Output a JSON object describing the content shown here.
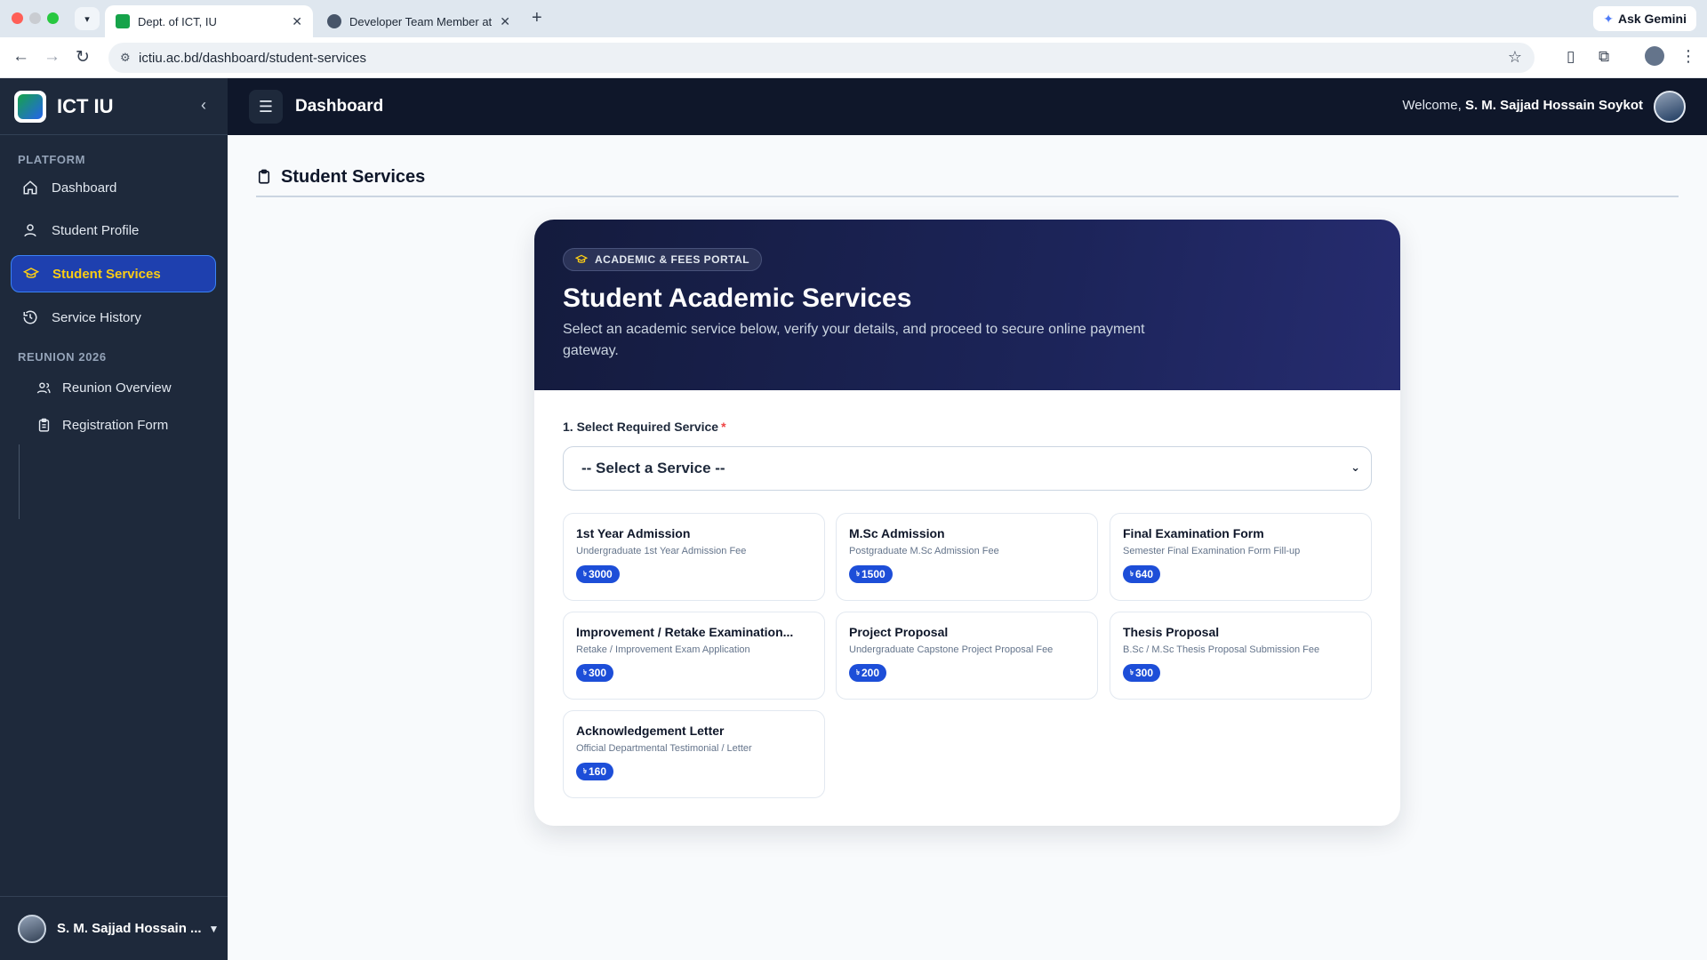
{
  "browser": {
    "tabs": [
      {
        "title": "Dept. of ICT, IU",
        "favicon_color": "#16a34a"
      },
      {
        "title": "Developer Team Member at D",
        "favicon_color": "#475569"
      }
    ],
    "url": "ictiu.ac.bd/dashboard/student-services",
    "ask_gemini": "Ask Gemini"
  },
  "sidebar": {
    "brand": "ICT IU",
    "platform_label": "PLATFORM",
    "items": [
      {
        "label": "Dashboard",
        "icon": "home-icon"
      },
      {
        "label": "Student Profile",
        "icon": "user-icon"
      },
      {
        "label": "Student Services",
        "icon": "graduation-cap-icon",
        "active": true
      },
      {
        "label": "Service History",
        "icon": "history-icon"
      }
    ],
    "reunion_label": "REUNION 2026",
    "reunion_items": [
      {
        "label": "Reunion Overview",
        "icon": "users-icon"
      },
      {
        "label": "Registration Form",
        "icon": "clipboard-icon"
      }
    ],
    "user": "S. M. Sajjad Hossain ..."
  },
  "header": {
    "title": "Dashboard",
    "welcome_prefix": "Welcome,",
    "user_name": "S. M. Sajjad Hossain Soykot"
  },
  "page": {
    "title": "Student Services"
  },
  "hero": {
    "badge": "ACADEMIC & FEES PORTAL",
    "title": "Student Academic Services",
    "subtitle": "Select an academic service below, verify your details, and proceed to secure online payment gateway."
  },
  "form": {
    "label": "1. Select Required Service",
    "required_mark": "*",
    "select_value": "-- Select a Service --"
  },
  "currency_symbol": "৳",
  "services": [
    {
      "title": "1st Year Admission",
      "desc": "Undergraduate 1st Year Admission Fee",
      "price": "3000"
    },
    {
      "title": "M.Sc Admission",
      "desc": "Postgraduate M.Sc Admission Fee",
      "price": "1500"
    },
    {
      "title": "Final Examination Form",
      "desc": "Semester Final Examination Form Fill-up",
      "price": "640"
    },
    {
      "title": "Improvement / Retake Examination...",
      "desc": "Retake / Improvement Exam Application",
      "price": "300"
    },
    {
      "title": "Project Proposal",
      "desc": "Undergraduate Capstone Project Proposal Fee",
      "price": "200"
    },
    {
      "title": "Thesis Proposal",
      "desc": "B.Sc / M.Sc Thesis Proposal Submission Fee",
      "price": "300"
    },
    {
      "title": "Acknowledgement Letter",
      "desc": "Official Departmental Testimonial / Letter",
      "price": "160"
    }
  ],
  "colors": {
    "sidebar_bg": "#1e293b",
    "header_bg": "#0f172a",
    "active_text": "#facc15",
    "price_badge": "#1d4ed8",
    "required": "#ef4444"
  }
}
